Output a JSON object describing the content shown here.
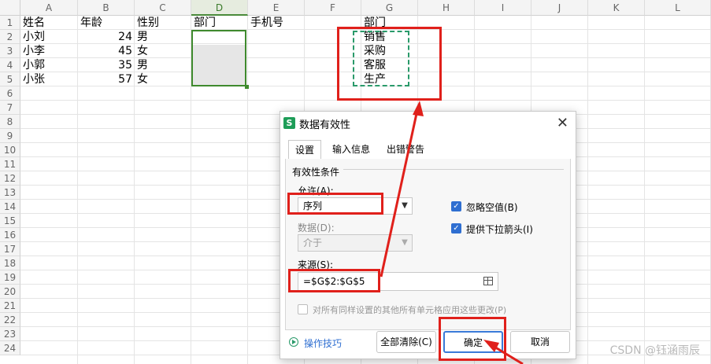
{
  "columns": [
    "A",
    "B",
    "C",
    "D",
    "E",
    "F",
    "G",
    "H",
    "I",
    "J",
    "K",
    "L"
  ],
  "rows": [
    "1",
    "2",
    "3",
    "4",
    "5",
    "6",
    "7",
    "8",
    "9",
    "10",
    "11",
    "12",
    "13",
    "14",
    "15",
    "16",
    "17",
    "18",
    "19",
    "20",
    "21",
    "22",
    "23",
    "24"
  ],
  "cells": {
    "A1": "姓名",
    "B1": "年龄",
    "C1": "性别",
    "D1": "部门",
    "E1": "手机号",
    "G1": "部门",
    "A2": "小刘",
    "B2": "24",
    "C2": "男",
    "G2": "销售",
    "A3": "小李",
    "B3": "45",
    "C3": "女",
    "G3": "采购",
    "A4": "小郭",
    "B4": "35",
    "C4": "男",
    "G4": "客服",
    "A5": "小张",
    "B5": "57",
    "C5": "女",
    "G5": "生产"
  },
  "dialog": {
    "logo": "S",
    "title": "数据有效性",
    "close": "✕",
    "tabs": [
      "设置",
      "输入信息",
      "出错警告"
    ],
    "section_title": "有效性条件",
    "allow_label": "允许(A):",
    "allow_value": "序列",
    "data_label": "数据(D):",
    "data_value": "介于",
    "source_label": "来源(S):",
    "source_value": "=$G$2:$G$5",
    "ignore_blank": "忽略空值(B)",
    "dropdown_arrow": "提供下拉箭头(I)",
    "apply_all": "对所有同样设置的其他所有单元格应用这些更改(P)",
    "tips": "操作技巧",
    "clear_all": "全部清除(C)",
    "ok": "确定",
    "cancel": "取消",
    "ignore_blank_checked": true,
    "dropdown_arrow_checked": true,
    "apply_all_checked": false
  },
  "watermark": "CSDN @钰涵雨辰",
  "colors": {
    "accent_green": "#3f8a2e",
    "annotation_red": "#e0201b",
    "checkbox_blue": "#2f6fd1"
  }
}
